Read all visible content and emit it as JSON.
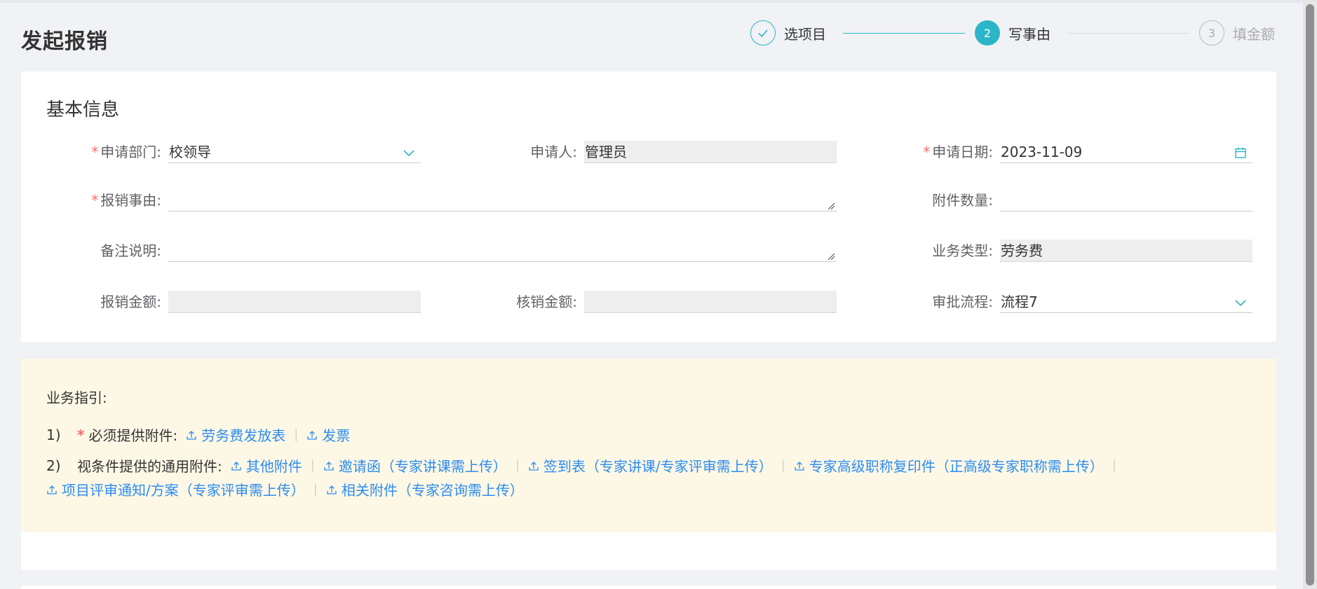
{
  "page": {
    "title": "发起报销"
  },
  "steps": [
    {
      "number": "",
      "label": "选项目",
      "state": "done"
    },
    {
      "number": "2",
      "label": "写事由",
      "state": "active"
    },
    {
      "number": "3",
      "label": "填金额",
      "state": "todo"
    }
  ],
  "basic_info": {
    "title": "基本信息",
    "fields": {
      "department": {
        "label": "申请部门:",
        "value": "校领导",
        "required": true
      },
      "applicant": {
        "label": "申请人:",
        "value": "管理员"
      },
      "date": {
        "label": "申请日期:",
        "value": "2023-11-09",
        "required": true
      },
      "reason": {
        "label": "报销事由:",
        "value": "",
        "required": true
      },
      "attachments_count": {
        "label": "附件数量:",
        "value": ""
      },
      "remark": {
        "label": "备注说明:",
        "value": ""
      },
      "business_type": {
        "label": "业务类型:",
        "value": "劳务费"
      },
      "reimburse_amount": {
        "label": "报销金额:",
        "value": ""
      },
      "verify_amount": {
        "label": "核销金额:",
        "value": ""
      },
      "approval_flow": {
        "label": "审批流程:",
        "value": "流程7"
      }
    }
  },
  "guide": {
    "title": "业务指引:",
    "required": {
      "num": "1)",
      "star": "*",
      "label": "必须提供附件:",
      "links": [
        "劳务费发放表",
        "发票"
      ]
    },
    "conditional": {
      "num": "2)",
      "label": "视条件提供的通用附件:",
      "links_line1": [
        "其他附件",
        "邀请函（专家讲课需上传）",
        "签到表（专家讲课/专家评审需上传）",
        "专家高级职称复印件（正高级专家职称需上传）"
      ],
      "links_line2": [
        "项目评审通知/方案（专家评审需上传）",
        "相关附件（专家咨询需上传）"
      ]
    }
  },
  "colors": {
    "accent": "#2bb5c8",
    "link": "#2d8cf0",
    "required": "#f56c6c",
    "guide_bg": "#fdf8e6"
  }
}
